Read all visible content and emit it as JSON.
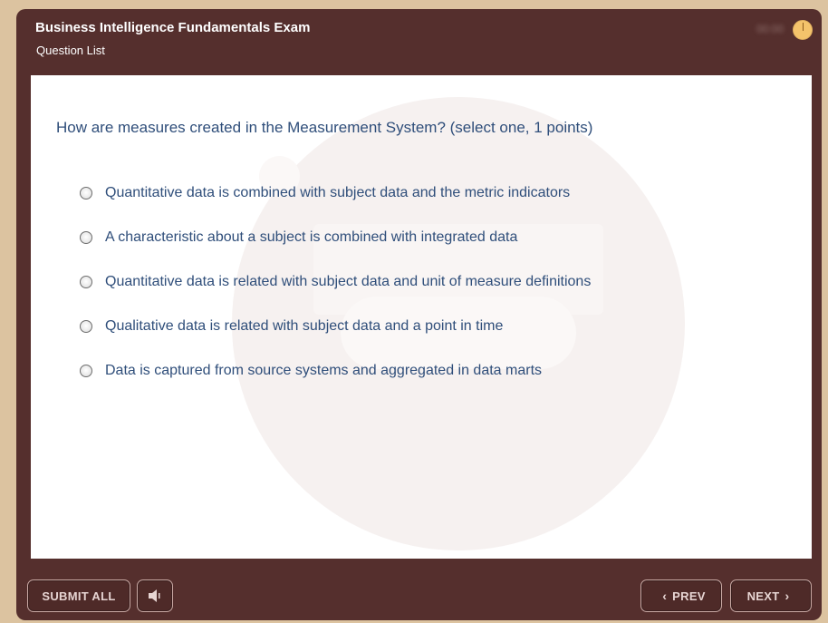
{
  "header": {
    "title": "Business Intelligence Fundamentals Exam",
    "subtitle": "Question List",
    "timer": "00:00"
  },
  "question": {
    "text": "How are measures created in the Measurement System?  (select one, 1 points)",
    "options": [
      "Quantitative data is combined with subject data and the metric indicators",
      "A characteristic about a subject is combined with integrated data",
      "Quantitative data is related with subject data and unit of measure definitions",
      "Qualitative data is related with subject data and a point in time",
      "Data is captured from source systems and aggregated in data marts"
    ],
    "selected_index": null
  },
  "footer": {
    "submit_label": "SUBMIT ALL",
    "prev_label": "PREV",
    "next_label": "NEXT"
  },
  "icons": {
    "timer": "clock-icon",
    "audio": "speaker-icon",
    "prev": "chevron-left-icon",
    "next": "chevron-right-icon"
  },
  "colors": {
    "window_bg": "#552f2d",
    "content_bg": "#ffffff",
    "text_blue": "#2f4e7a",
    "outer_bg": "#dcc3a0",
    "timer_accent": "#f4c36b"
  }
}
